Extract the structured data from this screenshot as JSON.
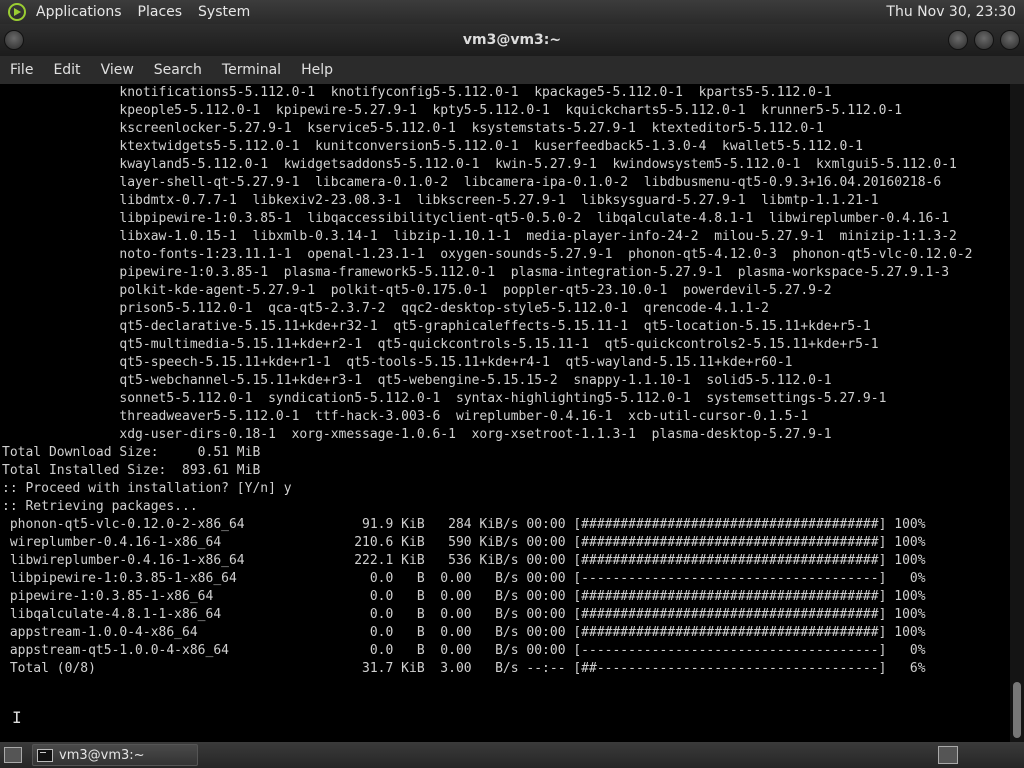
{
  "top_panel": {
    "menus": [
      "Applications",
      "Places",
      "System"
    ],
    "clock": "Thu Nov 30, 23:30"
  },
  "window": {
    "title": "vm3@vm3:~"
  },
  "menubar": [
    "File",
    "Edit",
    "View",
    "Search",
    "Terminal",
    "Help"
  ],
  "terminal": {
    "lines": [
      "               knotifications5-5.112.0-1  knotifyconfig5-5.112.0-1  kpackage5-5.112.0-1  kparts5-5.112.0-1",
      "               kpeople5-5.112.0-1  kpipewire-5.27.9-1  kpty5-5.112.0-1  kquickcharts5-5.112.0-1  krunner5-5.112.0-1",
      "               kscreenlocker-5.27.9-1  kservice5-5.112.0-1  ksystemstats-5.27.9-1  ktexteditor5-5.112.0-1",
      "               ktextwidgets5-5.112.0-1  kunitconversion5-5.112.0-1  kuserfeedback5-1.3.0-4  kwallet5-5.112.0-1",
      "               kwayland5-5.112.0-1  kwidgetsaddons5-5.112.0-1  kwin-5.27.9-1  kwindowsystem5-5.112.0-1  kxmlgui5-5.112.0-1",
      "               layer-shell-qt-5.27.9-1  libcamera-0.1.0-2  libcamera-ipa-0.1.0-2  libdbusmenu-qt5-0.9.3+16.04.20160218-6",
      "               libdmtx-0.7.7-1  libkexiv2-23.08.3-1  libkscreen-5.27.9-1  libksysguard-5.27.9-1  libmtp-1.1.21-1",
      "               libpipewire-1:0.3.85-1  libqaccessibilityclient-qt5-0.5.0-2  libqalculate-4.8.1-1  libwireplumber-0.4.16-1",
      "               libxaw-1.0.15-1  libxmlb-0.3.14-1  libzip-1.10.1-1  media-player-info-24-2  milou-5.27.9-1  minizip-1:1.3-2",
      "               noto-fonts-1:23.11.1-1  openal-1.23.1-1  oxygen-sounds-5.27.9-1  phonon-qt5-4.12.0-3  phonon-qt5-vlc-0.12.0-2",
      "               pipewire-1:0.3.85-1  plasma-framework5-5.112.0-1  plasma-integration-5.27.9-1  plasma-workspace-5.27.9.1-3",
      "               polkit-kde-agent-5.27.9-1  polkit-qt5-0.175.0-1  poppler-qt5-23.10.0-1  powerdevil-5.27.9-2",
      "               prison5-5.112.0-1  qca-qt5-2.3.7-2  qqc2-desktop-style5-5.112.0-1  qrencode-4.1.1-2",
      "               qt5-declarative-5.15.11+kde+r32-1  qt5-graphicaleffects-5.15.11-1  qt5-location-5.15.11+kde+r5-1",
      "               qt5-multimedia-5.15.11+kde+r2-1  qt5-quickcontrols-5.15.11-1  qt5-quickcontrols2-5.15.11+kde+r5-1",
      "               qt5-speech-5.15.11+kde+r1-1  qt5-tools-5.15.11+kde+r4-1  qt5-wayland-5.15.11+kde+r60-1",
      "               qt5-webchannel-5.15.11+kde+r3-1  qt5-webengine-5.15.15-2  snappy-1.1.10-1  solid5-5.112.0-1",
      "               sonnet5-5.112.0-1  syndication5-5.112.0-1  syntax-highlighting5-5.112.0-1  systemsettings-5.27.9-1",
      "               threadweaver5-5.112.0-1  ttf-hack-3.003-6  wireplumber-0.4.16-1  xcb-util-cursor-0.1.5-1",
      "               xdg-user-dirs-0.18-1  xorg-xmessage-1.0.6-1  xorg-xsetroot-1.1.3-1  plasma-desktop-5.27.9-1",
      "",
      "Total Download Size:     0.51 MiB",
      "Total Installed Size:  893.61 MiB",
      "",
      ":: Proceed with installation? [Y/n] y",
      ":: Retrieving packages...",
      " phonon-qt5-vlc-0.12.0-2-x86_64               91.9 KiB   284 KiB/s 00:00 [######################################] 100%",
      " wireplumber-0.4.16-1-x86_64                 210.6 KiB   590 KiB/s 00:00 [######################################] 100%",
      " libwireplumber-0.4.16-1-x86_64              222.1 KiB   536 KiB/s 00:00 [######################################] 100%",
      " libpipewire-1:0.3.85-1-x86_64                 0.0   B  0.00   B/s 00:00 [--------------------------------------]   0%",
      " pipewire-1:0.3.85-1-x86_64                    0.0   B  0.00   B/s 00:00 [######################################] 100%",
      " libqalculate-4.8.1-1-x86_64                   0.0   B  0.00   B/s 00:00 [######################################] 100%",
      " appstream-1.0.0-4-x86_64                      0.0   B  0.00   B/s 00:00 [######################################] 100%",
      " appstream-qt5-1.0.0-4-x86_64                  0.0   B  0.00   B/s 00:00 [--------------------------------------]   0%",
      " Total (0/8)                                  31.7 KiB  3.00   B/s --:-- [##------------------------------------]   6%"
    ]
  },
  "taskbar": {
    "window_button": "vm3@vm3:~"
  },
  "cursor_glyph": "I"
}
